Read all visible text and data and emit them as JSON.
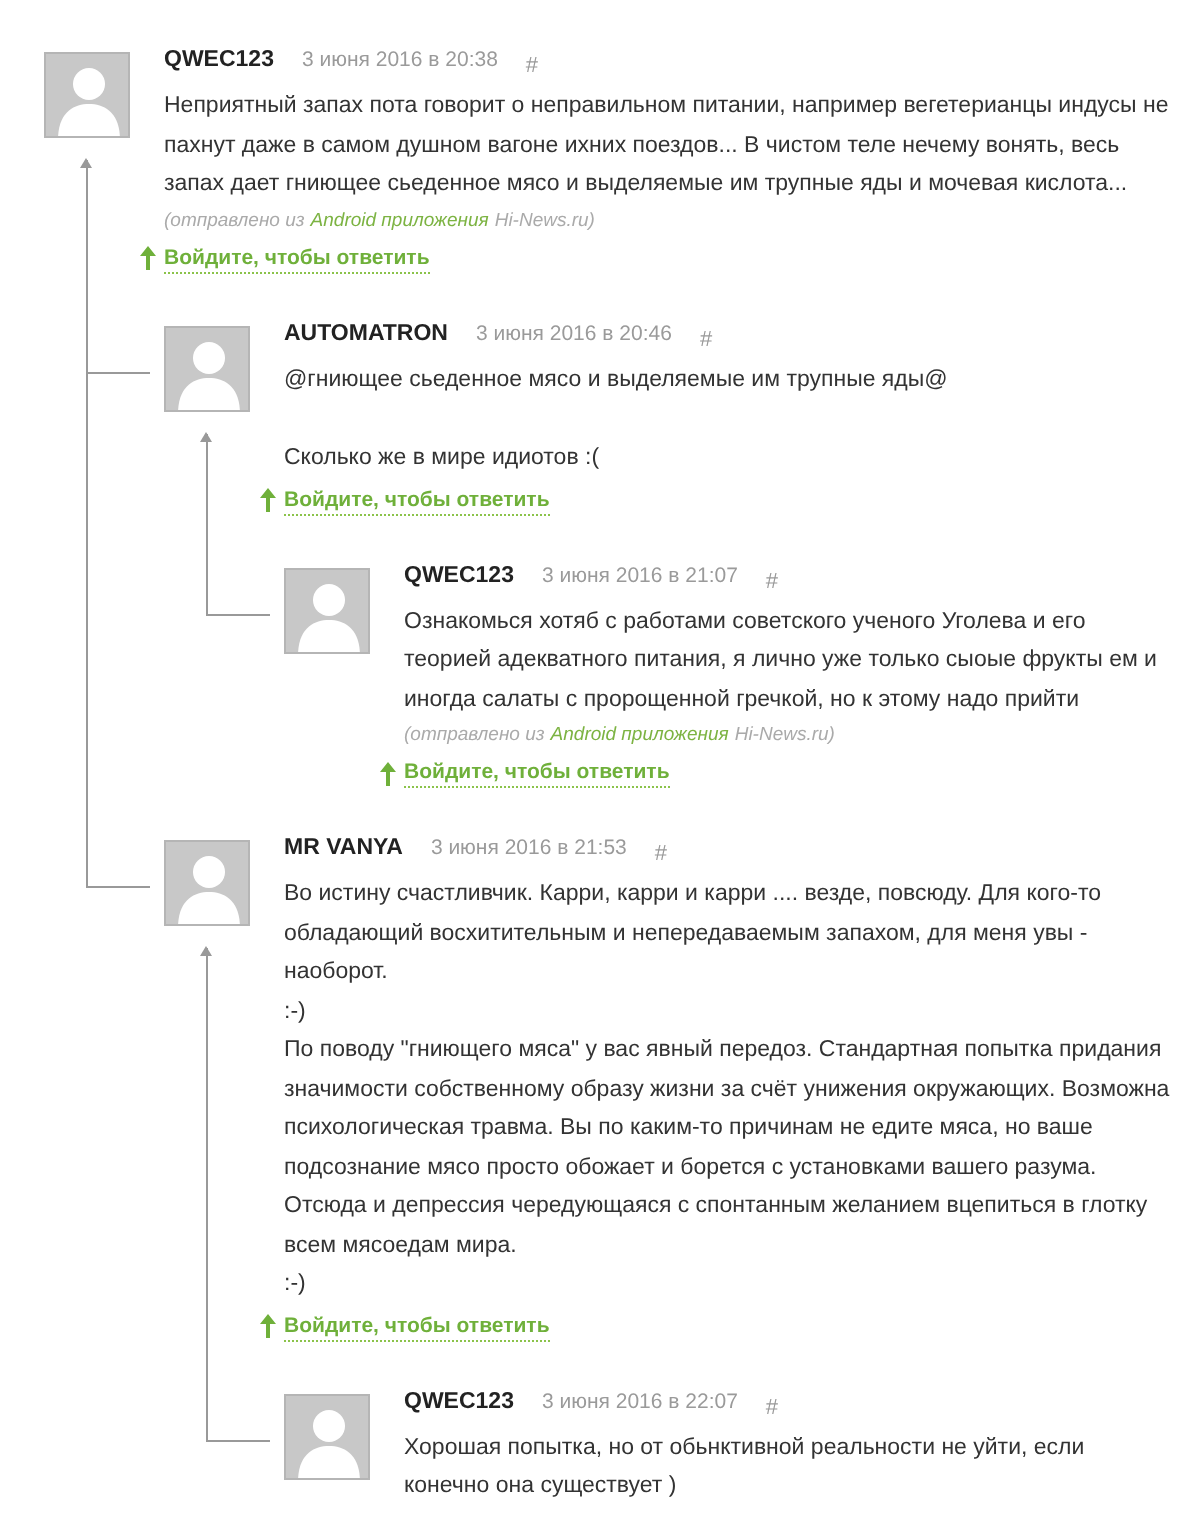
{
  "comments": [
    {
      "author": "QWEC123",
      "date": "3 июня 2016 в 20:38",
      "anchor": "#",
      "paragraphs": [
        "Неприятный запах пота говорит о неправильном питании, например вегетерианцы индусы не пахнут даже в самом душном вагоне ихних поездов... В чистом теле нечему вонять, весь запах дает гниющее сьеденное мясо и выделяемые им трупные яды и мочевая кислота..."
      ],
      "source": {
        "prefix": "(отправлено из",
        "link": "Android приложения",
        "suffix": "Hi-News.ru)"
      },
      "reply_link": "Войдите, чтобы ответить",
      "children": [
        {
          "author": "AUTOMATRON",
          "date": "3 июня 2016 в 20:46",
          "anchor": "#",
          "blank_line_between": true,
          "paragraphs": [
            "@гниющее сьеденное мясо и выделяемые им трупные яды@",
            "Сколько же в мире идиотов :("
          ],
          "reply_link": "Войдите, чтобы ответить",
          "children": [
            {
              "author": "QWEC123",
              "date": "3 июня 2016 в 21:07",
              "anchor": "#",
              "paragraphs": [
                "Ознакомься хотяб с работами советского ученого Уголева и его теорией адекватного питания, я лично уже только сыоые фрукты ем и иногда салаты с пророщенной гречкой, но к этому надо прийти"
              ],
              "source": {
                "prefix": "(отправлено из",
                "link": "Android приложения",
                "suffix": "Hi-News.ru)"
              },
              "reply_link": "Войдите, чтобы ответить"
            }
          ]
        },
        {
          "author": "MR VANYA",
          "date": "3 июня 2016 в 21:53",
          "anchor": "#",
          "blank_line_between": false,
          "paragraphs": [
            "Во истину счастливчик. Карри, карри и карри .... везде, повсюду. Для кого-то обладающий восхитительным и непередаваемым запахом, для меня увы - наоборот.",
            ":-)",
            "По поводу \"гниющего мяса\" у вас явный передоз. Стандартная попытка придания значимости собственному образу жизни за счёт унижения окружающих. Возможна психологическая травма. Вы по каким-то причинам не едите мяса, но ваше подсознание мясо просто обожает и борется с установками вашего разума. Отсюда и депрессия чередующаяся с спонтанным желанием вцепиться в глотку всем мясоедам мира.",
            ":-)"
          ],
          "reply_link": "Войдите, чтобы ответить",
          "children": [
            {
              "author": "QWEC123",
              "date": "3 июня 2016 в 22:07",
              "anchor": "#",
              "paragraphs": [
                "Хорошая попытка, но от обьнктивной реальности не уйти, если конечно она существует )"
              ]
            }
          ]
        }
      ]
    }
  ]
}
